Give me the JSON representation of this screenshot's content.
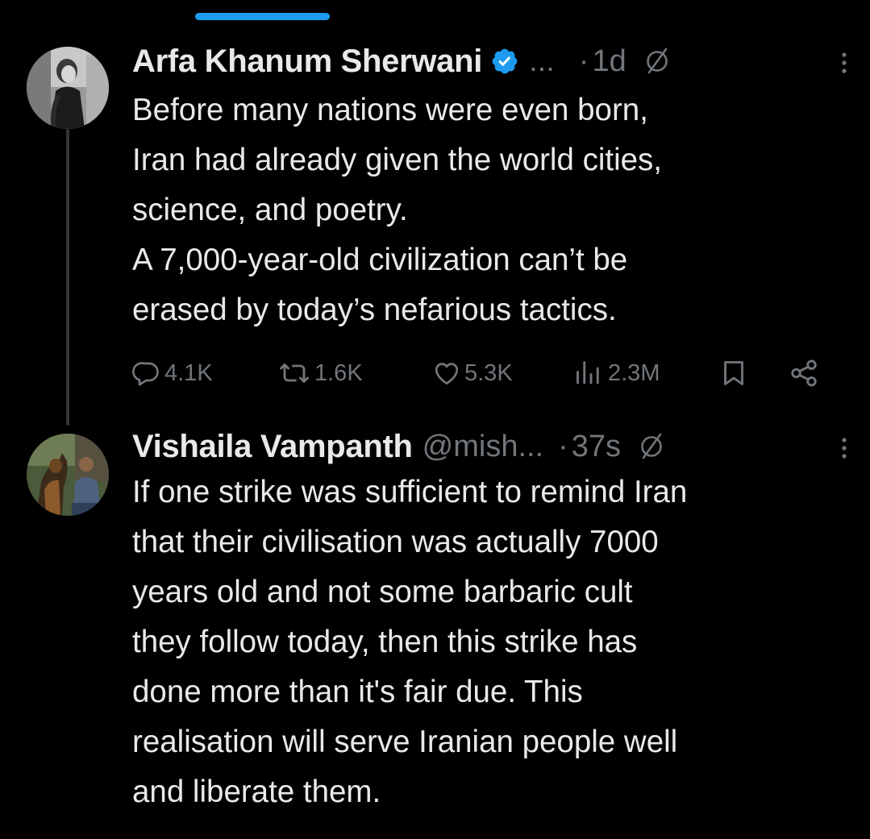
{
  "colors": {
    "background": "#000000",
    "text_primary": "#e7e9ea",
    "text_secondary": "#71767b",
    "accent": "#1d9bf0"
  },
  "tweets": [
    {
      "author_name": "Arfa Khanum Sherwani",
      "verified": true,
      "handle": "...",
      "separator": "·",
      "time": "1d",
      "avatar_icon": "avatar-photo",
      "text_lines": [
        "Before many nations were even born,",
        "Iran had already given the world cities,",
        "science, and poetry.",
        "A 7,000-year-old civilization can’t be",
        "erased by today’s nefarious tactics."
      ],
      "stats": {
        "replies": "4.1K",
        "reposts": "1.6K",
        "likes": "5.3K",
        "views": "2.3M"
      }
    },
    {
      "author_name": "Vishaila Vampanth",
      "verified": false,
      "handle": "@mish...",
      "separator": "·",
      "time": "37s",
      "avatar_icon": "avatar-photo-with-dog",
      "text_lines": [
        "If one strike was sufficient to remind Iran",
        "that their civilisation was actually 7000",
        "years old and not some barbaric cult",
        "they follow today, then this strike has",
        "done more than it's fair due. This",
        "realisation will serve Iranian people well",
        "and liberate them."
      ]
    }
  ]
}
